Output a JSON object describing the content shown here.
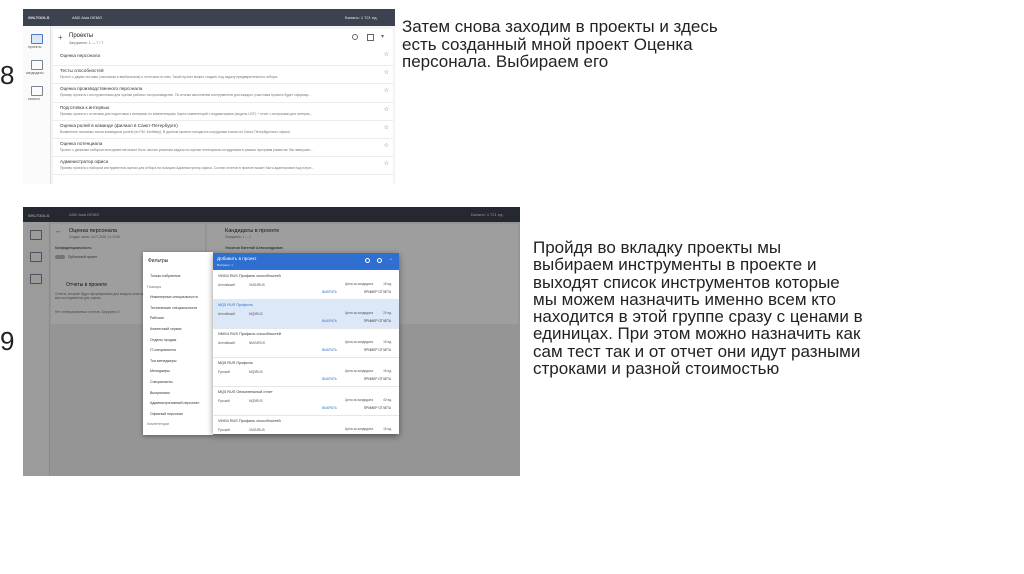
{
  "step1": {
    "number": "8",
    "caption": "Затем снова заходим в проекты и здесь есть созданный мной проект Оценка персонала. Выбираем его",
    "app": {
      "brand": "SHLTOOLS",
      "org": "AND Asia DEMO",
      "balance": "Баланс: 1 721 ед.",
      "sidebar": [
        "проекты",
        "кандидаты",
        "каталог"
      ],
      "header_title": "Проекты",
      "header_sub": "Загружено: 1 — 7 / 7",
      "projects": [
        {
          "title": "Оценка персонала",
          "desc": ""
        },
        {
          "title": "Тесты способностей",
          "desc": "Проект с двумя тестами (числовым и вербальным) и отчетами по ним. Такой проект можно создать под задачу предварительного отбора."
        },
        {
          "title": "Оценка производственного персонала",
          "desc": "Пример проекта с инструментами для оценки рабочих на производстве. По итогам заполнения инструментов для каждого участника проекта будет сформир..."
        },
        {
          "title": "Подготовка к интервью",
          "desc": "Пример проекта с отчетами для подготовки к интервью по компетенциям. Карта компетенций с индикаторами (модель UCF) + отчет с вопросами для интервь..."
        },
        {
          "title": "Оценка ролей в команде (филиал в Санкт-Петербурге)",
          "desc": "Выявление основных типов командных ролей (по Р.М. Белбину). В данном проекте находятся сотрудники только из Санкт-Петербургского офиса."
        },
        {
          "title": "Оценка потенциала",
          "desc": "Проект с данными набором инструментов может быть частью решения задачи по оценке потенциала сотрудников в рамках программ развития. Вы завершен..."
        },
        {
          "title": "Администратор офиса",
          "desc": "Пример проекта с набором инструментов оценки для отбора на позицию Администратор офиса. Состав отчетов в проекте может быть адаптирован под потре..."
        }
      ]
    }
  },
  "step2": {
    "number": "9",
    "caption": "Пройдя во вкладку проекты мы выбираем инструменты в проекте и выходят список инструментов которые мы можем назначить именно всем кто находится в этой группе сразу с ценами в единицах. При этом можно назначить как сам тест так и от отчет они идут разными строками и разной стоимостью",
    "app": {
      "org": "AND Asia DEMO",
      "balance": "Баланс: 1 721 ед.",
      "project_title": "Оценка персонала",
      "project_sub": "Создан: июля 14.07.2020, 11:13:40",
      "conf_label": "Конфиденциальность",
      "public_project": "Публичный проект",
      "reports_title": "Отчеты в проекте",
      "reports_note": "Отчеты, которые будут сформированы для каждого участника проекта после выполнения им всех инструментов для оценки.",
      "reports_count": "Нет сгенерированных отчетов. Загружено 0",
      "candidates_title": "Кандидаты в проекте",
      "candidates_sub": "Загружено: 1 — 1",
      "candidate_name": "Ульянов Евгений Александрович",
      "filters": {
        "title": "Фильтры",
        "items": [
          "Только избранные",
          "Позиция",
          "Инженерные специальности",
          "Технические специальности",
          "Рабочие",
          "Клиентский сервис",
          "Отделы продаж",
          "IT-специалисты",
          "Топ-менеджеры",
          "Менеджеры",
          "Специалисты",
          "Выпускники",
          "Административный персонал",
          "Офисный персонал",
          "Компетенции"
        ]
      },
      "modal": {
        "title": "Добавить в проект",
        "subtitle": "Выбрано: 1",
        "price_label": "Цена за кандидата",
        "btn_choose": "ВЫБРАТЬ",
        "btn_example": "ПРИМЕР ОТЧЕТА",
        "rows": [
          {
            "name": "VMG4 RUS Профиль способностей",
            "lang": "Английский",
            "code": "VMG4RUS",
            "price": "15 ед.",
            "selected": false
          },
          {
            "name": "MQ5 RUS Профиль",
            "lang": "Английский",
            "code": "MQ5RUS",
            "price": "20 ед.",
            "selected": true
          },
          {
            "name": "NMG4 RUS Профиль способностей",
            "lang": "Английский",
            "code": "NMG4RUS",
            "price": "15 ед.",
            "selected": false
          },
          {
            "name": "MQ5 RUS Профиль",
            "lang": "Русский",
            "code": "MQ5RUS",
            "price": "15 ед.",
            "selected": false
          },
          {
            "name": "MQ5 RUS Описательный отчет",
            "lang": "Русский",
            "code": "MQ5RUS",
            "price": "40 ед.",
            "selected": false
          },
          {
            "name": "VMG4 RUS Профиль способностей",
            "lang": "Русский",
            "code": "VMG4RUS",
            "price": "15 ед.",
            "selected": false
          }
        ]
      }
    }
  }
}
